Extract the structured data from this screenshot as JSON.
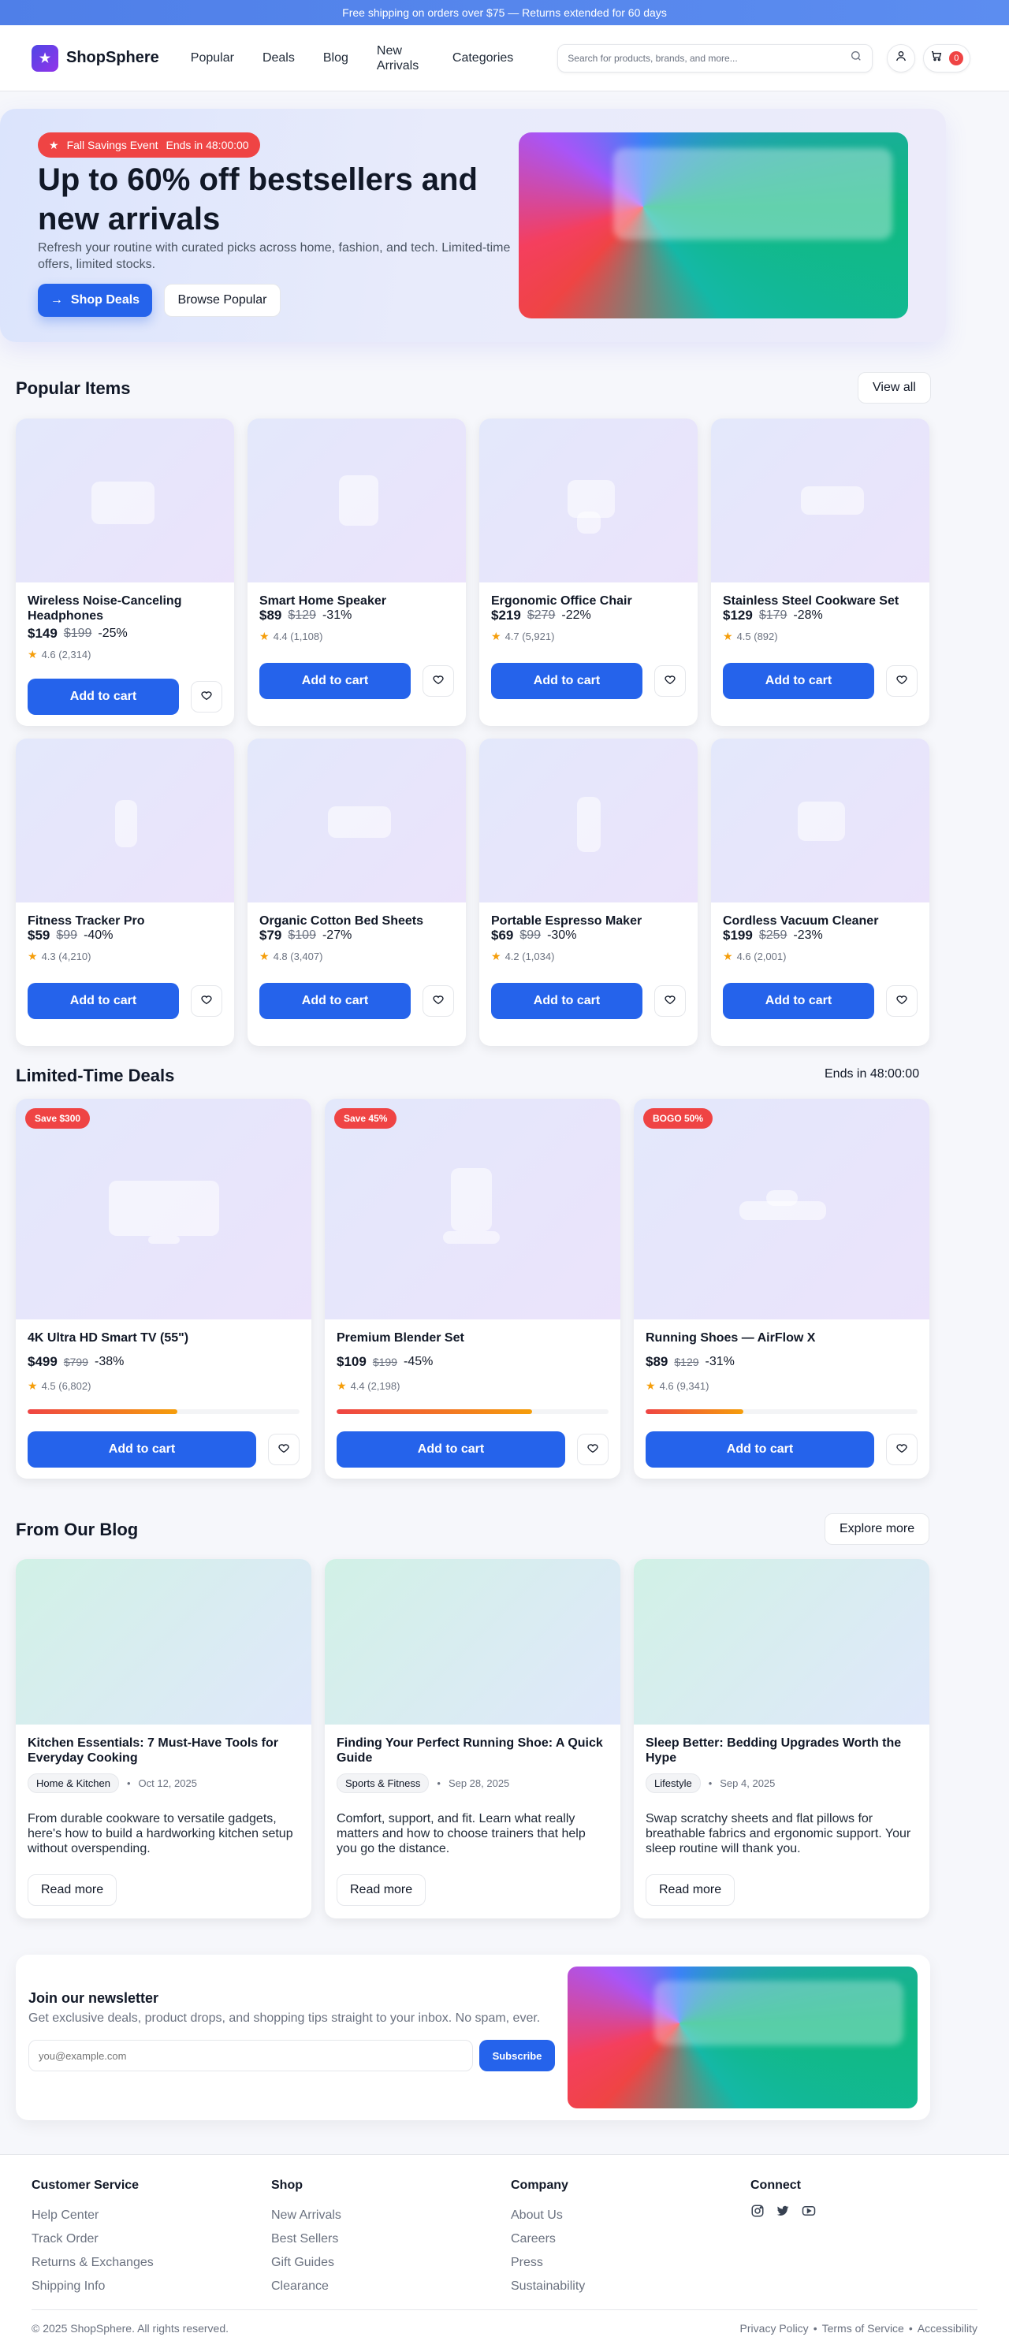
{
  "topbar": {
    "text": "Free shipping on orders over $75 — Returns extended for 60 days"
  },
  "header": {
    "brand": "ShopSphere",
    "nav": [
      "Popular",
      "Deals",
      "Blog",
      "New Arrivals",
      "Categories"
    ],
    "search_placeholder": "Search for products, brands, and more...",
    "cart_count": "0"
  },
  "hero": {
    "badge": "Fall Savings Event",
    "countdown": "Ends in 48:00:00",
    "title": "Up to 60% off bestsellers and new arrivals",
    "subtitle": "Refresh your routine with curated picks across home, fashion, and tech. Limited-time offers, limited stocks.",
    "shop_label": "Shop Deals",
    "browse_label": "Browse Popular"
  },
  "popular": {
    "title": "Popular Items",
    "view_all": "View all",
    "add_label": "Add to cart",
    "items": [
      {
        "name": "Wireless Noise-Canceling Headphones",
        "price": "$149",
        "old": "$199",
        "disc": "-25%",
        "rating": "4.6 (2,314)"
      },
      {
        "name": "Smart Home Speaker",
        "price": "$89",
        "old": "$129",
        "disc": "-31%",
        "rating": "4.4 (1,108)"
      },
      {
        "name": "Ergonomic Office Chair",
        "price": "$219",
        "old": "$279",
        "disc": "-22%",
        "rating": "4.7 (5,921)"
      },
      {
        "name": "Stainless Steel Cookware Set",
        "price": "$129",
        "old": "$179",
        "disc": "-28%",
        "rating": "4.5 (892)"
      },
      {
        "name": "Fitness Tracker Pro",
        "price": "$59",
        "old": "$99",
        "disc": "-40%",
        "rating": "4.3 (4,210)"
      },
      {
        "name": "Organic Cotton Bed Sheets",
        "price": "$79",
        "old": "$109",
        "disc": "-27%",
        "rating": "4.8 (3,407)"
      },
      {
        "name": "Portable Espresso Maker",
        "price": "$69",
        "old": "$99",
        "disc": "-30%",
        "rating": "4.2 (1,034)"
      },
      {
        "name": "Cordless Vacuum Cleaner",
        "price": "$199",
        "old": "$259",
        "disc": "-23%",
        "rating": "4.6 (2,001)"
      }
    ]
  },
  "deals": {
    "title": "Limited-Time Deals",
    "countdown": "Ends in 48:00:00",
    "add_label": "Add to cart",
    "items": [
      {
        "badge": "Save $300",
        "name": "4K Ultra HD Smart TV (55\")",
        "price": "$499",
        "old": "$799",
        "disc": "-38%",
        "rating": "4.5 (6,802)",
        "sold_fraction": 0.55
      },
      {
        "badge": "Save 45%",
        "name": "Premium Blender Set",
        "price": "$109",
        "old": "$199",
        "disc": "-45%",
        "rating": "4.4 (2,198)",
        "sold_fraction": 0.72
      },
      {
        "badge": "BOGO 50%",
        "name": "Running Shoes — AirFlow X",
        "price": "$89",
        "old": "$129",
        "disc": "-31%",
        "rating": "4.6 (9,341)",
        "sold_fraction": 0.36
      }
    ]
  },
  "blog": {
    "title": "From Our Blog",
    "explore": "Explore more",
    "read_more": "Read more",
    "posts": [
      {
        "title": "Kitchen Essentials: 7 Must-Have Tools for Everyday Cooking",
        "category": "Home & Kitchen",
        "date": "Oct 12, 2025",
        "excerpt": "From durable cookware to versatile gadgets, here's how to build a hardworking kitchen setup without overspending."
      },
      {
        "title": "Finding Your Perfect Running Shoe: A Quick Guide",
        "category": "Sports & Fitness",
        "date": "Sep 28, 2025",
        "excerpt": "Comfort, support, and fit. Learn what really matters and how to choose trainers that help you go the distance."
      },
      {
        "title": "Sleep Better: Bedding Upgrades Worth the Hype",
        "category": "Lifestyle",
        "date": "Sep 4, 2025",
        "excerpt": "Swap scratchy sheets and flat pillows for breathable fabrics and ergonomic support. Your sleep routine will thank you."
      }
    ]
  },
  "newsletter": {
    "title": "Join our newsletter",
    "subtitle": "Get exclusive deals, product drops, and shopping tips straight to your inbox. No spam, ever.",
    "placeholder": "you@example.com",
    "button": "Subscribe"
  },
  "footer": {
    "columns": [
      {
        "title": "Customer Service",
        "links": [
          "Help Center",
          "Track Order",
          "Returns & Exchanges",
          "Shipping Info"
        ]
      },
      {
        "title": "Shop",
        "links": [
          "New Arrivals",
          "Best Sellers",
          "Gift Guides",
          "Clearance"
        ]
      },
      {
        "title": "Company",
        "links": [
          "About Us",
          "Careers",
          "Press",
          "Sustainability"
        ]
      },
      {
        "title": "Connect",
        "icons": [
          "instagram-icon",
          "twitter-icon",
          "youtube-icon"
        ]
      }
    ],
    "copyright": "© 2025 ShopSphere. All rights reserved.",
    "legal": [
      "Privacy Policy",
      "Terms of Service",
      "Accessibility"
    ],
    "legal_sep": "•"
  },
  "colors": {
    "accent": "#2563eb",
    "sale": "#ef4444",
    "star": "#f59e0b"
  }
}
